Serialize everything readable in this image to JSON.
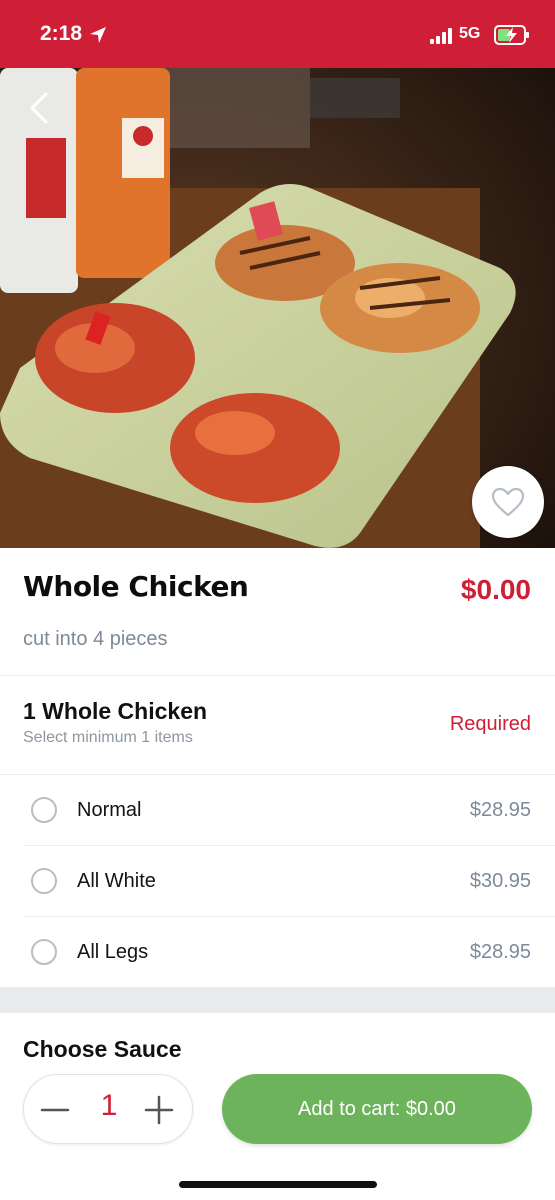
{
  "status_bar": {
    "time": "2:18",
    "network": "5G",
    "background_color": "#cf1f36",
    "icons": [
      "location-icon",
      "signal-icon",
      "battery-charging-icon"
    ]
  },
  "hero": {
    "image_description_icon": "food-photo",
    "back_icon": "chevron-left-icon",
    "favorite_icon": "heart-icon"
  },
  "product": {
    "title": "Whole Chicken",
    "price": "$0.00",
    "description": "cut into 4 pieces"
  },
  "option_group": {
    "title": "1 Whole Chicken",
    "subtitle": "Select minimum 1 items",
    "required_label": "Required",
    "options": [
      {
        "label": "Normal",
        "price": "$28.95",
        "selected": false
      },
      {
        "label": "All White",
        "price": "$30.95",
        "selected": false
      },
      {
        "label": "All Legs",
        "price": "$28.95",
        "selected": false
      }
    ]
  },
  "next_section": {
    "title": "Choose Sauce"
  },
  "cart": {
    "quantity": "1",
    "add_label": "Add to cart: $0.00",
    "button_color": "#6db35b",
    "accent_color": "#cf1f36"
  }
}
